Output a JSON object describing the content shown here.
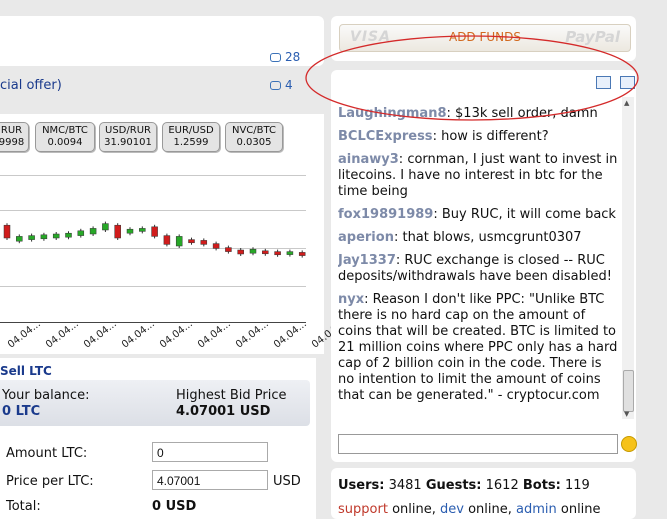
{
  "news": [
    {
      "text": "",
      "comments": "28"
    },
    {
      "text": "cial offer)",
      "comments": "4"
    }
  ],
  "tickers": [
    {
      "name": "RUR",
      "value": "9998"
    },
    {
      "name": "NMC/BTC",
      "value": "0.0094"
    },
    {
      "name": "USD/RUR",
      "value": "31.90101"
    },
    {
      "name": "EUR/USD",
      "value": "1.2599"
    },
    {
      "name": "NVC/BTC",
      "value": "0.0305"
    }
  ],
  "chart": {
    "x_ticks": [
      "04.04...",
      "04.04...",
      "04.04...",
      "04.04...",
      "04.04...",
      "04.04...",
      "04.04...",
      "04.04...",
      "04.04..."
    ],
    "candles": [
      {
        "o": 3.0,
        "c": 4.6,
        "up": false
      },
      {
        "o": 2.6,
        "c": 3.2,
        "up": true
      },
      {
        "o": 2.8,
        "c": 3.3,
        "up": true
      },
      {
        "o": 2.9,
        "c": 3.4,
        "up": true
      },
      {
        "o": 3.0,
        "c": 3.5,
        "up": true
      },
      {
        "o": 3.1,
        "c": 3.6,
        "up": true
      },
      {
        "o": 3.3,
        "c": 3.9,
        "up": true
      },
      {
        "o": 3.5,
        "c": 4.2,
        "up": true
      },
      {
        "o": 4.0,
        "c": 4.8,
        "up": true
      },
      {
        "o": 4.6,
        "c": 3.0,
        "up": false
      },
      {
        "o": 3.6,
        "c": 4.1,
        "up": true
      },
      {
        "o": 3.9,
        "c": 4.2,
        "up": true
      },
      {
        "o": 3.2,
        "c": 4.4,
        "up": false
      },
      {
        "o": 2.2,
        "c": 3.3,
        "up": false
      },
      {
        "o": 2.0,
        "c": 3.2,
        "up": true
      },
      {
        "o": 2.8,
        "c": 2.4,
        "up": false
      },
      {
        "o": 2.7,
        "c": 2.2,
        "up": false
      },
      {
        "o": 2.3,
        "c": 1.7,
        "up": false
      },
      {
        "o": 1.8,
        "c": 1.3,
        "up": false
      },
      {
        "o": 1.5,
        "c": 1.0,
        "up": false
      },
      {
        "o": 1.1,
        "c": 1.6,
        "up": true
      },
      {
        "o": 1.4,
        "c": 1.1,
        "up": false
      },
      {
        "o": 1.3,
        "c": 0.9,
        "up": false
      },
      {
        "o": 1.0,
        "c": 1.3,
        "up": true
      },
      {
        "o": 1.2,
        "c": 0.8,
        "up": false
      }
    ]
  },
  "sell": {
    "title": "Sell LTC",
    "balance_label": "Your balance:",
    "balance_value": "0 LTC",
    "bid_label": "Highest Bid Price",
    "bid_value": "4.07001 USD",
    "amount_label": "Amount LTC:",
    "amount_value": "0",
    "price_label": "Price per LTC:",
    "price_value": "4.07001",
    "price_unit": "USD",
    "total_label": "Total:",
    "total_value": "0 USD"
  },
  "funds": {
    "visa": "VISA",
    "label": "ADD FUNDS",
    "paypal": "PayPal"
  },
  "chat": {
    "messages": [
      {
        "user": "Laughingman8",
        "text": "$13k sell order, damn"
      },
      {
        "user": "BCLCExpress",
        "text": "how is different?"
      },
      {
        "user": "ainawy3",
        "text": "cornman, I just want to invest in litecoins. I have no interest in btc for the time being"
      },
      {
        "user": "fox19891989",
        "text": "Buy RUC, it will come back"
      },
      {
        "user": "aperion",
        "text": "that blows, usmcgrunt0307"
      },
      {
        "user": "Jay1337",
        "text": "RUC exchange is closed -- RUC deposits/withdrawals have been disabled!"
      },
      {
        "user": "nyx",
        "text": "Reason I don't like PPC: \"Unlike BTC there is no hard cap on the amount of coins that will be created. BTC is limited to 21 million coins where PPC only has a hard cap of 2 billion coin in the code. There is no intention to limit the amount of coins that can be generated.\" - cryptocur.com"
      }
    ],
    "input_value": ""
  },
  "stats": {
    "users_label": "Users:",
    "users_value": "3481",
    "guests_label": "Guests:",
    "guests_value": "1612",
    "bots_label": "Bots:",
    "bots_value": "119",
    "staff": [
      {
        "name": "support",
        "status": "online",
        "color": "#c0392b"
      },
      {
        "name": "dev",
        "status": "online",
        "color": "#2a5db0"
      },
      {
        "name": "admin",
        "status": "online",
        "color": "#2a5db0"
      }
    ]
  },
  "colors": {
    "candle_up": "#27a827",
    "candle_down": "#d01c1c",
    "annotation": "#d42a2a"
  }
}
